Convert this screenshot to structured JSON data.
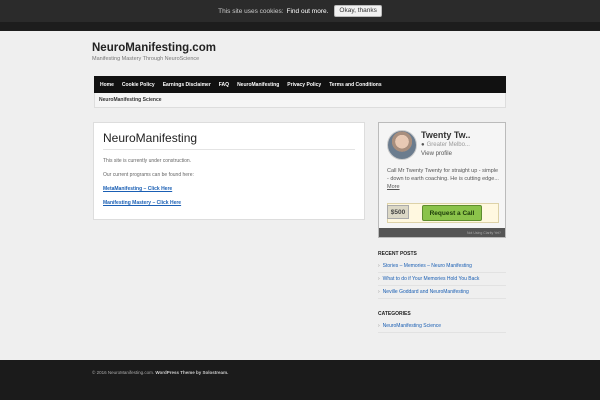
{
  "cookie": {
    "message": "This site uses cookies:",
    "link": "Find out more.",
    "button": "Okay, thanks"
  },
  "site": {
    "title": "NeuroManifesting.com",
    "description": "Manifesting Mastery Through NeuroScience"
  },
  "nav": {
    "items": [
      "Home",
      "Cookie Policy",
      "Earnings Disclaimer",
      "FAQ",
      "NeuroManifesting",
      "Privacy Policy",
      "Terms and Conditions"
    ],
    "subitem": "NeuroManifesting Science"
  },
  "main": {
    "heading": "NeuroManifesting",
    "line1": "This site is currently under construction.",
    "line2": "Our current programs can be found here:",
    "link1": "MetaManifesting – Click Here",
    "link2": "Manifesting Mastery – Click Here"
  },
  "profile": {
    "name": "Twenty Tw..",
    "location": "Greater Melbo...",
    "view": "View profile",
    "bio": "Call Mr Twenty Twenty for straight up - simple - down to earth coaching. He is cutting edge...",
    "more": "More",
    "price": "$500",
    "call": "Request a Call",
    "footer": "Not Using Clarity Yet?"
  },
  "recent_posts": {
    "title": "RECENT POSTS",
    "items": [
      "Stories – Memories – Neuro Manifesting",
      "What to do if Your Memories Hold You Back",
      "Neville Goddard and NeuroManifesting"
    ]
  },
  "categories": {
    "title": "CATEGORIES",
    "items": [
      "NeuroManifesting Science"
    ]
  },
  "footer": {
    "copyright": "© 2016 NeuroManifesting.com.",
    "theme": "WordPress Theme by Solostream."
  }
}
